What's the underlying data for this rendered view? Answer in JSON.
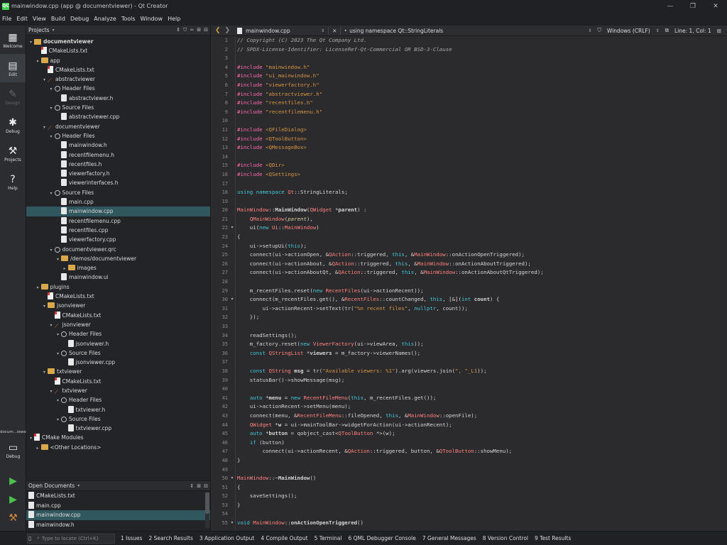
{
  "window": {
    "title": "mainwindow.cpp (app @ documentviewer) - Qt Creator",
    "logo": "QC"
  },
  "menu": [
    "File",
    "Edit",
    "View",
    "Build",
    "Debug",
    "Analyze",
    "Tools",
    "Window",
    "Help"
  ],
  "modes": [
    {
      "label": "Welcome",
      "icon": "grid-icon",
      "glyph": "▦"
    },
    {
      "label": "Edit",
      "icon": "document-edit-icon",
      "glyph": "▤"
    },
    {
      "label": "Design",
      "icon": "pen-icon",
      "glyph": "✎"
    },
    {
      "label": "Debug",
      "icon": "bug-icon",
      "glyph": "✱"
    },
    {
      "label": "Projects",
      "icon": "wrench-icon",
      "glyph": "⚒"
    },
    {
      "label": "Help",
      "icon": "help-icon",
      "glyph": "?"
    }
  ],
  "kit": {
    "label": "docum...iewer",
    "mode": "Debug"
  },
  "projects_header": "Projects",
  "tree": [
    {
      "d": 0,
      "a": "▾",
      "i": "proj",
      "t": "documentviewer",
      "b": true
    },
    {
      "d": 1,
      "a": "",
      "i": "red",
      "t": "CMakeLists.txt"
    },
    {
      "d": 1,
      "a": "▾",
      "i": "folder",
      "t": "app"
    },
    {
      "d": 2,
      "a": "",
      "i": "red",
      "t": "CMakeLists.txt"
    },
    {
      "d": 2,
      "a": "▾",
      "i": "wrench",
      "t": "abstractviewer"
    },
    {
      "d": 3,
      "a": "▾",
      "i": "filter",
      "t": "Header Files"
    },
    {
      "d": 4,
      "a": "",
      "i": "file",
      "t": "abstractviewer.h"
    },
    {
      "d": 3,
      "a": "▾",
      "i": "filter",
      "t": "Source Files"
    },
    {
      "d": 4,
      "a": "",
      "i": "file",
      "t": "abstractviewer.cpp"
    },
    {
      "d": 2,
      "a": "▾",
      "i": "wrench",
      "t": "documentviewer"
    },
    {
      "d": 3,
      "a": "▾",
      "i": "filter",
      "t": "Header Files"
    },
    {
      "d": 4,
      "a": "",
      "i": "file",
      "t": "mainwindow.h"
    },
    {
      "d": 4,
      "a": "",
      "i": "file",
      "t": "recentfilemenu.h"
    },
    {
      "d": 4,
      "a": "",
      "i": "file",
      "t": "recentfiles.h"
    },
    {
      "d": 4,
      "a": "",
      "i": "file",
      "t": "viewerfactory.h"
    },
    {
      "d": 4,
      "a": "",
      "i": "file",
      "t": "viewerinterfaces.h"
    },
    {
      "d": 3,
      "a": "▾",
      "i": "filter",
      "t": "Source Files"
    },
    {
      "d": 4,
      "a": "",
      "i": "file",
      "t": "main.cpp"
    },
    {
      "d": 4,
      "a": "",
      "i": "file",
      "t": "mainwindow.cpp",
      "sel": true
    },
    {
      "d": 4,
      "a": "",
      "i": "file",
      "t": "recentfilemenu.cpp"
    },
    {
      "d": 4,
      "a": "",
      "i": "file",
      "t": "recentfiles.cpp"
    },
    {
      "d": 4,
      "a": "",
      "i": "file",
      "t": "viewerfactory.cpp"
    },
    {
      "d": 3,
      "a": "▾",
      "i": "filter",
      "t": "documentviewer.qrc"
    },
    {
      "d": 4,
      "a": "▾",
      "i": "folder",
      "t": "/demos/documentviewer"
    },
    {
      "d": 5,
      "a": "▸",
      "i": "folder",
      "t": "images"
    },
    {
      "d": 4,
      "a": "",
      "i": "file",
      "t": "mainwindow.ui"
    },
    {
      "d": 1,
      "a": "▾",
      "i": "folder",
      "t": "plugins"
    },
    {
      "d": 2,
      "a": "",
      "i": "red",
      "t": "CMakeLists.txt"
    },
    {
      "d": 2,
      "a": "▾",
      "i": "folder",
      "t": "jsonviewer"
    },
    {
      "d": 3,
      "a": "",
      "i": "red",
      "t": "CMakeLists.txt"
    },
    {
      "d": 3,
      "a": "▾",
      "i": "wrench",
      "t": "jsonviewer"
    },
    {
      "d": 4,
      "a": "▾",
      "i": "filter",
      "t": "Header Files"
    },
    {
      "d": 5,
      "a": "",
      "i": "file",
      "t": "jsonviewer.h"
    },
    {
      "d": 4,
      "a": "▾",
      "i": "filter",
      "t": "Source Files"
    },
    {
      "d": 5,
      "a": "",
      "i": "file",
      "t": "jsonviewer.cpp"
    },
    {
      "d": 2,
      "a": "▾",
      "i": "folder",
      "t": "txtviewer"
    },
    {
      "d": 3,
      "a": "",
      "i": "red",
      "t": "CMakeLists.txt"
    },
    {
      "d": 3,
      "a": "▾",
      "i": "wrench",
      "t": "txtviewer"
    },
    {
      "d": 4,
      "a": "▾",
      "i": "filter",
      "t": "Header Files"
    },
    {
      "d": 5,
      "a": "",
      "i": "file",
      "t": "txtviewer.h"
    },
    {
      "d": 4,
      "a": "▾",
      "i": "filter",
      "t": "Source Files"
    },
    {
      "d": 5,
      "a": "",
      "i": "file",
      "t": "txtviewer.cpp"
    },
    {
      "d": 0,
      "a": "▾",
      "i": "red",
      "t": "CMake Modules"
    },
    {
      "d": 1,
      "a": "▸",
      "i": "folder",
      "t": "<Other Locations>"
    }
  ],
  "open_documents_header": "Open Documents",
  "open_documents": [
    {
      "t": "CMakeLists.txt"
    },
    {
      "t": "main.cpp"
    },
    {
      "t": "mainwindow.cpp",
      "sel": true
    },
    {
      "t": "mainwindow.h"
    }
  ],
  "editor_bar": {
    "file": "mainwindow.cpp",
    "symbol": "using namespace Qt::StringLiterals",
    "encoding": "Windows (CRLF)",
    "position": "Line: 1, Col: 1"
  },
  "code": [
    {
      "n": "1",
      "f": "",
      "s": [
        [
          "c-com",
          "// Copyright (C) 2023 The Qt Company Ltd."
        ]
      ]
    },
    {
      "n": "2",
      "f": "",
      "s": [
        [
          "c-com",
          "// SPDX-License-Identifier: LicenseRef-Qt-Commercial OR BSD-3-Clause"
        ]
      ]
    },
    {
      "n": "3",
      "f": "",
      "s": []
    },
    {
      "n": "4",
      "f": "",
      "s": [
        [
          "c-pp",
          "#include "
        ],
        [
          "c-str",
          "\"mainwindow.h\""
        ]
      ]
    },
    {
      "n": "5",
      "f": "",
      "s": [
        [
          "c-pp",
          "#include "
        ],
        [
          "c-str",
          "\"ui_mainwindow.h\""
        ]
      ]
    },
    {
      "n": "6",
      "f": "",
      "s": [
        [
          "c-pp",
          "#include "
        ],
        [
          "c-str",
          "\"viewerfactory.h\""
        ]
      ]
    },
    {
      "n": "7",
      "f": "",
      "s": [
        [
          "c-pp",
          "#include "
        ],
        [
          "c-str",
          "\"abstractviewer.h\""
        ]
      ]
    },
    {
      "n": "8",
      "f": "",
      "s": [
        [
          "c-pp",
          "#include "
        ],
        [
          "c-str",
          "\"recentfiles.h\""
        ]
      ]
    },
    {
      "n": "9",
      "f": "",
      "s": [
        [
          "c-pp",
          "#include "
        ],
        [
          "c-str",
          "\"recentfilemenu.h\""
        ]
      ]
    },
    {
      "n": "10",
      "f": "",
      "s": []
    },
    {
      "n": "11",
      "f": "",
      "s": [
        [
          "c-pp",
          "#include "
        ],
        [
          "c-str",
          "<QFileDialog>"
        ]
      ]
    },
    {
      "n": "12",
      "f": "",
      "s": [
        [
          "c-pp",
          "#include "
        ],
        [
          "c-str",
          "<QToolButton>"
        ]
      ]
    },
    {
      "n": "13",
      "f": "",
      "s": [
        [
          "c-pp",
          "#include "
        ],
        [
          "c-str",
          "<QMessageBox>"
        ]
      ]
    },
    {
      "n": "14",
      "f": "",
      "s": []
    },
    {
      "n": "15",
      "f": "",
      "s": [
        [
          "c-pp",
          "#include "
        ],
        [
          "c-str",
          "<QDir>"
        ]
      ]
    },
    {
      "n": "16",
      "f": "",
      "s": [
        [
          "c-pp",
          "#include "
        ],
        [
          "c-str",
          "<QSettings>"
        ]
      ]
    },
    {
      "n": "17",
      "f": "",
      "s": []
    },
    {
      "n": "18",
      "f": "",
      "s": [
        [
          "c-kw",
          "using namespace "
        ],
        [
          "c-type",
          "Qt"
        ],
        [
          "c-plain",
          "::StringLiterals;"
        ]
      ]
    },
    {
      "n": "19",
      "f": "",
      "s": []
    },
    {
      "n": "20",
      "f": "",
      "s": [
        [
          "c-type",
          "MainWindow"
        ],
        [
          "c-plain",
          "::"
        ],
        [
          "c-bold",
          "MainWindow"
        ],
        [
          "c-plain",
          "("
        ],
        [
          "c-type",
          "QWidget"
        ],
        [
          "c-plain",
          " *"
        ],
        [
          "c-bold",
          "parent"
        ],
        [
          "c-plain",
          ") :"
        ]
      ]
    },
    {
      "n": "21",
      "f": "",
      "s": [
        [
          "c-plain",
          "    "
        ],
        [
          "c-type",
          "QMainWindow"
        ],
        [
          "c-plain",
          "("
        ],
        [
          "c-it",
          "parent"
        ],
        [
          "c-plain",
          "),"
        ]
      ]
    },
    {
      "n": "22",
      "f": "▾",
      "s": [
        [
          "c-plain",
          "    ui("
        ],
        [
          "c-kw",
          "new "
        ],
        [
          "c-type",
          "Ui"
        ],
        [
          "c-plain",
          "::"
        ],
        [
          "c-type",
          "MainWindow"
        ],
        [
          "c-plain",
          ")"
        ]
      ]
    },
    {
      "n": "23",
      "f": "",
      "s": [
        [
          "c-plain",
          "{"
        ]
      ]
    },
    {
      "n": "24",
      "f": "",
      "s": [
        [
          "c-plain",
          "    ui->setupUi("
        ],
        [
          "c-kw",
          "this"
        ],
        [
          "c-plain",
          ");"
        ]
      ]
    },
    {
      "n": "25",
      "f": "",
      "s": [
        [
          "c-plain",
          "    connect(ui->actionOpen, &"
        ],
        [
          "c-type",
          "QAction"
        ],
        [
          "c-plain",
          "::triggered, "
        ],
        [
          "c-kw",
          "this"
        ],
        [
          "c-plain",
          ", &"
        ],
        [
          "c-type",
          "MainWindow"
        ],
        [
          "c-plain",
          "::onActionOpenTriggered);"
        ]
      ]
    },
    {
      "n": "26",
      "f": "",
      "s": [
        [
          "c-plain",
          "    connect(ui->actionAbout, &"
        ],
        [
          "c-type",
          "QAction"
        ],
        [
          "c-plain",
          "::triggered, "
        ],
        [
          "c-kw",
          "this"
        ],
        [
          "c-plain",
          ", &"
        ],
        [
          "c-type",
          "MainWindow"
        ],
        [
          "c-plain",
          "::onActionAboutTriggered);"
        ]
      ]
    },
    {
      "n": "27",
      "f": "",
      "s": [
        [
          "c-plain",
          "    connect(ui->actionAboutQt, &"
        ],
        [
          "c-type",
          "QAction"
        ],
        [
          "c-plain",
          "::triggered, "
        ],
        [
          "c-kw",
          "this"
        ],
        [
          "c-plain",
          ", &"
        ],
        [
          "c-type",
          "MainWindow"
        ],
        [
          "c-plain",
          "::onActionAboutQtTriggered);"
        ]
      ]
    },
    {
      "n": "28",
      "f": "",
      "s": []
    },
    {
      "n": "29",
      "f": "",
      "s": [
        [
          "c-plain",
          "    m_recentFiles.reset("
        ],
        [
          "c-kw",
          "new "
        ],
        [
          "c-type",
          "RecentFiles"
        ],
        [
          "c-plain",
          "(ui->actionRecent));"
        ]
      ]
    },
    {
      "n": "30",
      "f": "▾",
      "s": [
        [
          "c-plain",
          "    connect(m_recentFiles.get(), &"
        ],
        [
          "c-type",
          "RecentFiles"
        ],
        [
          "c-plain",
          "::countChanged, "
        ],
        [
          "c-kw",
          "this"
        ],
        [
          "c-plain",
          ", [&]("
        ],
        [
          "c-kw",
          "int "
        ],
        [
          "c-bold",
          "count"
        ],
        [
          "c-plain",
          ") {"
        ]
      ]
    },
    {
      "n": "31",
      "f": "",
      "s": [
        [
          "c-plain",
          "        ui->actionRecent->setText(tr("
        ],
        [
          "c-str",
          "\"%n recent files\""
        ],
        [
          "c-plain",
          ", "
        ],
        [
          "c-kw",
          "nullptr"
        ],
        [
          "c-plain",
          ", count));"
        ]
      ]
    },
    {
      "n": "32",
      "f": "",
      "s": [
        [
          "c-plain",
          "    });"
        ]
      ]
    },
    {
      "n": "33",
      "f": "",
      "s": []
    },
    {
      "n": "34",
      "f": "",
      "s": [
        [
          "c-plain",
          "    readSettings();"
        ]
      ]
    },
    {
      "n": "35",
      "f": "",
      "s": [
        [
          "c-plain",
          "    m_factory.reset("
        ],
        [
          "c-kw",
          "new "
        ],
        [
          "c-type",
          "ViewerFactory"
        ],
        [
          "c-plain",
          "(ui->viewArea, "
        ],
        [
          "c-kw",
          "this"
        ],
        [
          "c-plain",
          "));"
        ]
      ]
    },
    {
      "n": "36",
      "f": "",
      "s": [
        [
          "c-plain",
          "    "
        ],
        [
          "c-kw",
          "const "
        ],
        [
          "c-type",
          "QStringList"
        ],
        [
          "c-plain",
          " *"
        ],
        [
          "c-bold",
          "viewers"
        ],
        [
          "c-plain",
          " = m_factory->viewerNames();"
        ]
      ]
    },
    {
      "n": "37",
      "f": "",
      "s": []
    },
    {
      "n": "38",
      "f": "",
      "s": [
        [
          "c-plain",
          "    "
        ],
        [
          "c-kw",
          "const "
        ],
        [
          "c-type",
          "QString"
        ],
        [
          "c-plain",
          " "
        ],
        [
          "c-bold",
          "msg"
        ],
        [
          "c-plain",
          " = tr("
        ],
        [
          "c-str",
          "\"Available viewers: %1\""
        ],
        [
          "c-plain",
          ").arg(viewers.join("
        ],
        [
          "c-str",
          "\", \"_L1"
        ],
        [
          "c-plain",
          "));"
        ]
      ]
    },
    {
      "n": "39",
      "f": "",
      "s": [
        [
          "c-plain",
          "    statusBar()->showMessage(msg);"
        ]
      ]
    },
    {
      "n": "40",
      "f": "",
      "s": []
    },
    {
      "n": "41",
      "f": "",
      "s": [
        [
          "c-plain",
          "    "
        ],
        [
          "c-kw",
          "auto "
        ],
        [
          "c-plain",
          "*"
        ],
        [
          "c-bold",
          "menu"
        ],
        [
          "c-plain",
          " = "
        ],
        [
          "c-kw",
          "new "
        ],
        [
          "c-type",
          "RecentFileMenu"
        ],
        [
          "c-plain",
          "("
        ],
        [
          "c-kw",
          "this"
        ],
        [
          "c-plain",
          ", m_recentFiles.get());"
        ]
      ]
    },
    {
      "n": "42",
      "f": "",
      "s": [
        [
          "c-plain",
          "    ui->actionRecent->setMenu(menu);"
        ]
      ]
    },
    {
      "n": "43",
      "f": "",
      "s": [
        [
          "c-plain",
          "    connect(menu, &"
        ],
        [
          "c-type",
          "RecentFileMenu"
        ],
        [
          "c-plain",
          "::fileOpened, "
        ],
        [
          "c-kw",
          "this"
        ],
        [
          "c-plain",
          ", &"
        ],
        [
          "c-type",
          "MainWindow"
        ],
        [
          "c-plain",
          "::openFile);"
        ]
      ]
    },
    {
      "n": "44",
      "f": "",
      "s": [
        [
          "c-plain",
          "    "
        ],
        [
          "c-type",
          "QWidget"
        ],
        [
          "c-plain",
          " *"
        ],
        [
          "c-bold",
          "w"
        ],
        [
          "c-plain",
          " = ui->mainToolBar->widgetForAction(ui->actionRecent);"
        ]
      ]
    },
    {
      "n": "45",
      "f": "",
      "s": [
        [
          "c-plain",
          "    "
        ],
        [
          "c-kw",
          "auto "
        ],
        [
          "c-plain",
          "*"
        ],
        [
          "c-bold",
          "button"
        ],
        [
          "c-plain",
          " = qobject_cast<"
        ],
        [
          "c-type",
          "QToolButton"
        ],
        [
          "c-plain",
          " *>(w);"
        ]
      ]
    },
    {
      "n": "46",
      "f": "",
      "s": [
        [
          "c-plain",
          "    "
        ],
        [
          "c-kw",
          "if "
        ],
        [
          "c-plain",
          "(button)"
        ]
      ]
    },
    {
      "n": "47",
      "f": "",
      "s": [
        [
          "c-plain",
          "        connect(ui->actionRecent, &"
        ],
        [
          "c-type",
          "QAction"
        ],
        [
          "c-plain",
          "::triggered, button, &"
        ],
        [
          "c-type",
          "QToolButton"
        ],
        [
          "c-plain",
          "::showMenu);"
        ]
      ]
    },
    {
      "n": "48",
      "f": "",
      "s": [
        [
          "c-plain",
          "}"
        ]
      ]
    },
    {
      "n": "49",
      "f": "",
      "s": []
    },
    {
      "n": "50",
      "f": "▾",
      "s": [
        [
          "c-type",
          "MainWindow"
        ],
        [
          "c-plain",
          "::~"
        ],
        [
          "c-bold",
          "MainWindow"
        ],
        [
          "c-plain",
          "()"
        ]
      ]
    },
    {
      "n": "51",
      "f": "",
      "s": [
        [
          "c-plain",
          "{"
        ]
      ]
    },
    {
      "n": "52",
      "f": "",
      "s": [
        [
          "c-plain",
          "    saveSettings();"
        ]
      ]
    },
    {
      "n": "53",
      "f": "",
      "s": [
        [
          "c-plain",
          "}"
        ]
      ]
    },
    {
      "n": "54",
      "f": "",
      "s": []
    },
    {
      "n": "55",
      "f": "▾",
      "s": [
        [
          "c-kw",
          "void "
        ],
        [
          "c-type",
          "MainWindow"
        ],
        [
          "c-plain",
          "::"
        ],
        [
          "c-bold",
          "onActionOpenTriggered"
        ],
        [
          "c-plain",
          "()"
        ]
      ]
    }
  ],
  "status": {
    "locator_placeholder": "Type to locate (Ctrl+K)",
    "tabs": [
      "1  Issues",
      "2  Search Results",
      "3  Application Output",
      "4  Compile Output",
      "5  Terminal",
      "6  QML Debugger Console",
      "7  General Messages",
      "8  Version Control",
      "9  Test Results"
    ]
  }
}
